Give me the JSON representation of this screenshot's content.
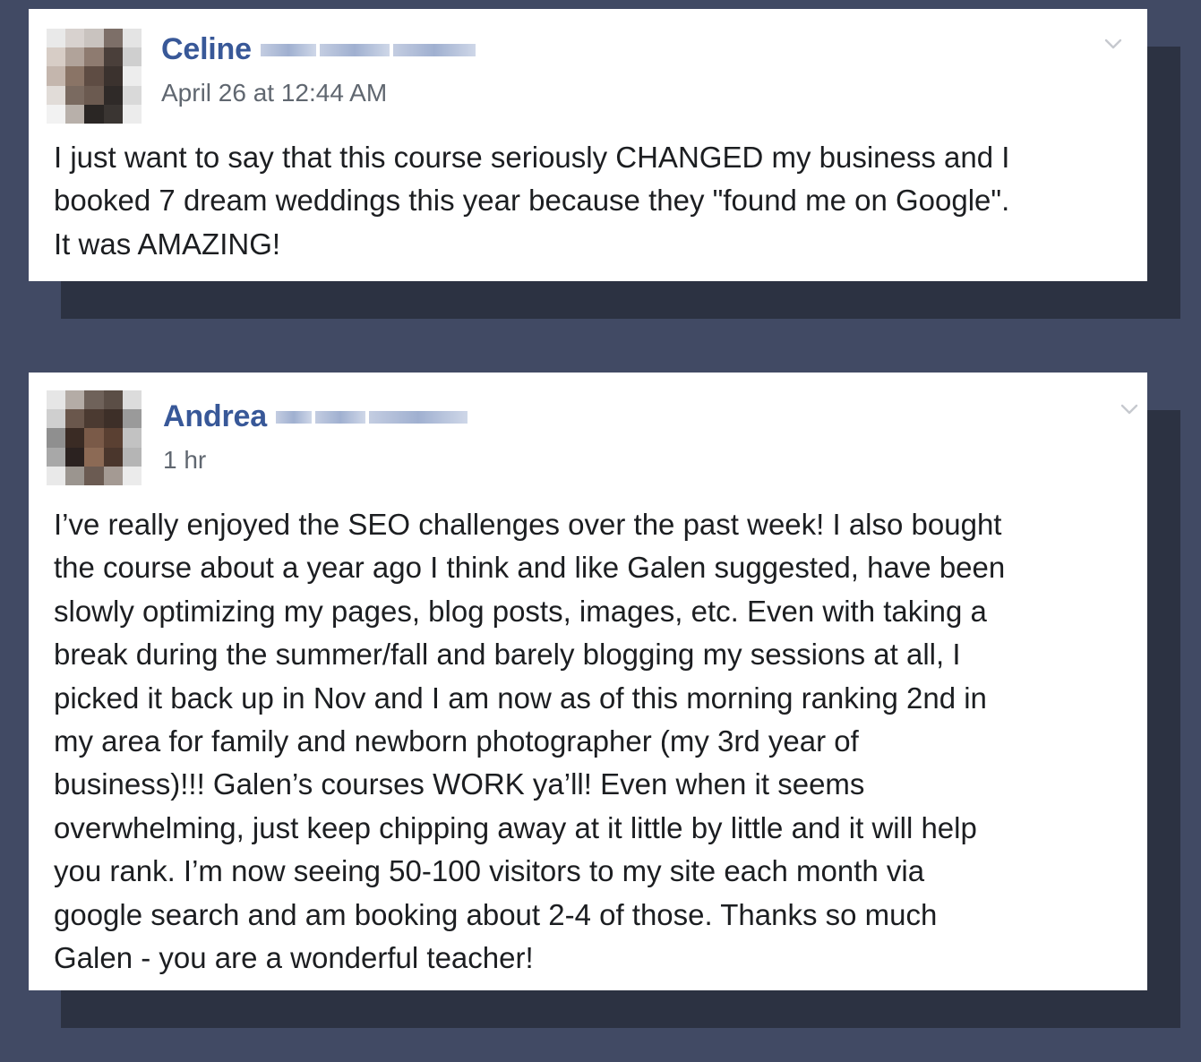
{
  "posts": [
    {
      "author_first_name": "Celine",
      "timestamp": "April 26 at 12:44 AM",
      "body": "I just want to say that this course seriously CHANGED my business and I\nbooked 7 dream weddings this year because they \"found me on Google\".\nIt was AMAZING!"
    },
    {
      "author_first_name": "Andrea",
      "timestamp": "1 hr",
      "body": "I’ve really enjoyed the SEO challenges over the past week! I also bought\nthe course about a year ago I think and like Galen suggested, have been\nslowly optimizing my pages, blog posts, images, etc. Even with taking a\nbreak during the summer/fall and barely blogging my sessions at all, I\npicked it back up in Nov and I am now as of this morning ranking 2nd in\nmy area for family and newborn photographer (my 3rd year of\nbusiness)!!! Galen’s courses WORK ya’ll! Even when it seems\noverwhelming, just keep chipping away at it little by little and it will help\nyou rank. I’m now seeing 50-100 visitors to my site each month via\ngoogle search and am booking about 2-4 of those. Thanks so much\nGalen - you are a wonderful teacher!"
    }
  ],
  "icons": {
    "post_menu": "chevron-down-icon"
  },
  "colors": {
    "background": "#414a64",
    "card": "#ffffff",
    "author_link": "#385898",
    "timestamp": "#606770",
    "text": "#1c1e21"
  }
}
